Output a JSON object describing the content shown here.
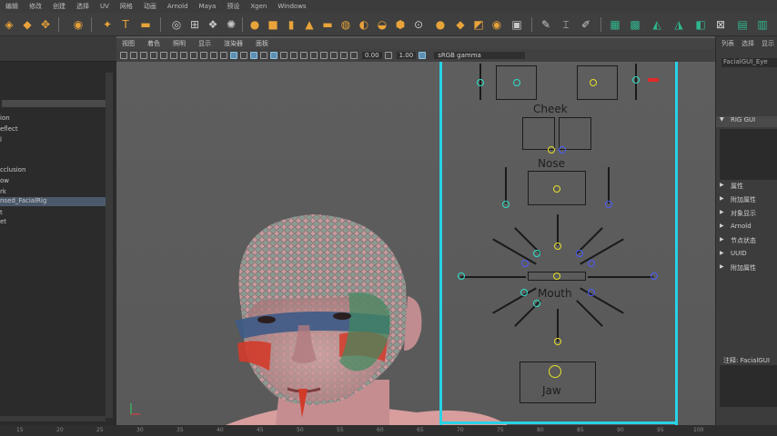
{
  "menubar": {
    "items": [
      "编辑",
      "修改",
      "创建",
      "选择",
      "UV",
      "网格",
      "动画",
      "Arnold",
      "Maya",
      "预设",
      "Xgen",
      "Windows"
    ]
  },
  "viewport": {
    "menu": [
      "视图",
      "着色",
      "照明",
      "显示",
      "渲染器",
      "面板"
    ],
    "exposure": "0.00",
    "gamma": "1.00",
    "color_space": "sRGB gamma"
  },
  "outliner": {
    "items": [
      {
        "label": "ion",
        "selected": false
      },
      {
        "label": "eflect",
        "selected": false
      },
      {
        "label": "l",
        "selected": false
      },
      {
        "label": "cclusion",
        "selected": false
      },
      {
        "label": "ow",
        "selected": false
      },
      {
        "label": "rk",
        "selected": false
      },
      {
        "label": "nsed_FacialRig",
        "selected": true
      },
      {
        "label": "t",
        "selected": false
      },
      {
        "label": "et",
        "selected": false
      }
    ]
  },
  "rig": {
    "cheek_label": "Cheek",
    "nose_label": "Nose",
    "mouth_label": "Mouth",
    "jaw_label": "Jaw"
  },
  "right_panel": {
    "tabs": [
      "列表",
      "选择",
      "显示"
    ],
    "node_field": "FacialGUI_Eye",
    "sections": [
      "RIG GUI",
      "属性",
      "附加属性",
      "对象显示",
      "Arnold",
      "节点状态",
      "UUID",
      "附加属性"
    ],
    "notes_label": "注释: FacialGUI"
  },
  "timeline": {
    "ticks": [
      "15",
      "20",
      "25",
      "30",
      "35",
      "40",
      "45",
      "50",
      "55",
      "60",
      "65",
      "70",
      "75",
      "80",
      "85",
      "90",
      "95",
      "100"
    ]
  },
  "colors": {
    "cyan_guide": "#28d2e6",
    "selection": "#4b5a6b"
  }
}
